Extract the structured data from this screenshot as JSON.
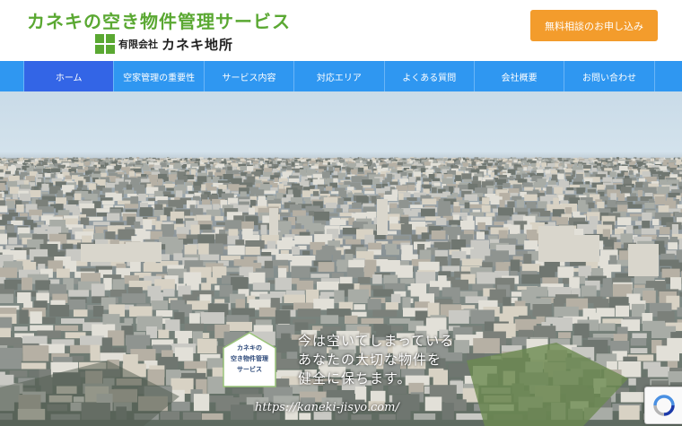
{
  "header": {
    "site_title": "カネキの空き物件管理サービス",
    "company_prefix": "有限会社",
    "company_name": "カネキ地所",
    "cta_label": "無料相談のお申し込み"
  },
  "nav": {
    "items": [
      {
        "label": "ホーム",
        "active": true
      },
      {
        "label": "空家管理の重要性",
        "active": false
      },
      {
        "label": "サービス内容",
        "active": false
      },
      {
        "label": "対応エリア",
        "active": false
      },
      {
        "label": "よくある質問",
        "active": false
      },
      {
        "label": "会社概要",
        "active": false
      },
      {
        "label": "お問い合わせ",
        "active": false
      }
    ]
  },
  "hero": {
    "badge": {
      "line1": "カネキの",
      "line2": "空き物件管理",
      "line3": "サービス"
    },
    "tagline": {
      "line1": "今は空いてしまっている",
      "line2": "あなたの大切な物件を",
      "line3": "健全に保ちます。"
    },
    "url": "https://kaneki-jisyo.com/"
  },
  "colors": {
    "brand_green": "#5aa832",
    "nav_blue": "#2f97f1",
    "nav_active": "#3365e6",
    "cta_orange": "#f39c2c"
  },
  "icons": {
    "company_logo": "green-squares-logo",
    "recaptcha": "recaptcha-icon"
  }
}
